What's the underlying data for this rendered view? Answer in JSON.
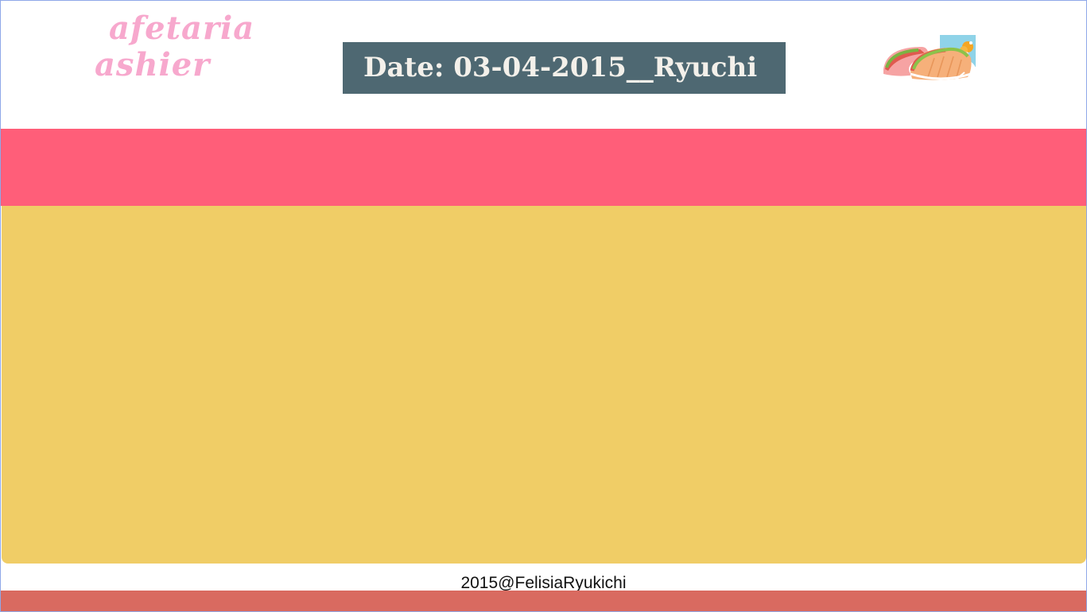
{
  "header": {
    "logo_line1": "afetaria",
    "logo_line2": "ashier",
    "date_label": "Date: 03-04-2015__Ryuchi",
    "illustration_icon": "sandwich-food-icon"
  },
  "footer": {
    "copyright": "2015@FelisiaRyukichi"
  },
  "colors": {
    "logo": "#f7a8cd",
    "date_box": "#4e6872",
    "pink_band": "#ff5e79",
    "content_panel": "#f0cd66",
    "footer_bar": "#d96a60"
  }
}
